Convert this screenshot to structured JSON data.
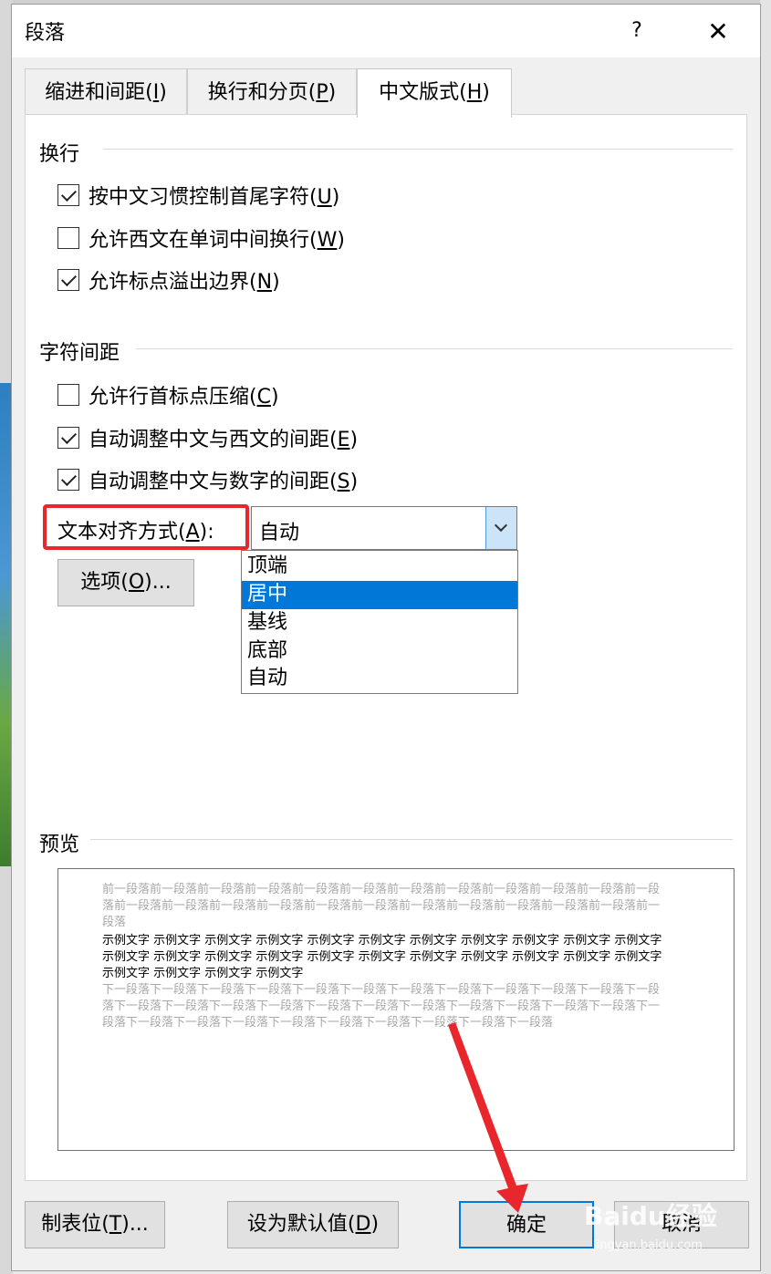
{
  "dialog": {
    "title": "段落",
    "help_label": "?",
    "close_label": "✕"
  },
  "tabs": [
    {
      "label_pre": "缩进和间距(",
      "label_key": "I",
      "label_post": ")"
    },
    {
      "label_pre": "换行和分页(",
      "label_key": "P",
      "label_post": ")"
    },
    {
      "label_pre": "中文版式(",
      "label_key": "H",
      "label_post": ")"
    }
  ],
  "line_break": {
    "title": "换行",
    "options": [
      {
        "pre": "按中文习惯控制首尾字符(",
        "key": "U",
        "post": ")",
        "checked": true
      },
      {
        "pre": "允许西文在单词中间换行(",
        "key": "W",
        "post": ")",
        "checked": false
      },
      {
        "pre": "允许标点溢出边界(",
        "key": "N",
        "post": ")",
        "checked": true
      }
    ]
  },
  "char_spacing": {
    "title": "字符间距",
    "options": [
      {
        "pre": "允许行首标点压缩(",
        "key": "C",
        "post": ")",
        "checked": false
      },
      {
        "pre": "自动调整中文与西文的间距(",
        "key": "E",
        "post": ")",
        "checked": true
      },
      {
        "pre": "自动调整中文与数字的间距(",
        "key": "S",
        "post": ")",
        "checked": true
      }
    ]
  },
  "text_alignment": {
    "label_pre": "文本对齐方式(",
    "label_key": "A",
    "label_post": "):",
    "value": "自动",
    "options": [
      "顶端",
      "居中",
      "基线",
      "底部",
      "自动"
    ],
    "highlighted_index": 1
  },
  "options_button": {
    "pre": "选项(",
    "key": "O",
    "post": ")..."
  },
  "preview": {
    "title": "预览",
    "prev_text": "前一段落前一段落前一段落前一段落前一段落前一段落前一段落前一段落前一段落前一段落前一段落前一段落前一段落前一段落前一段落前一段落前一段落前一段落前一段落前一段落前一段落前一段落前一段落前一段落",
    "sample_text": "示例文字  示例文字  示例文字  示例文字  示例文字  示例文字  示例文字  示例文字  示例文字  示例文字  示例文字  示例文字  示例文字  示例文字  示例文字  示例文字  示例文字  示例文字  示例文字  示例文字  示例文字  示例文字  示例文字  示例文字  示例文字  示例文字",
    "next_text": "下一段落下一段落下一段落下一段落下一段落下一段落下一段落下一段落下一段落下一段落下一段落下一段落下一段落下一段落下一段落下一段落下一段落下一段落下一段落下一段落下一段落下一段落下一段落下一段落下一段落下一段落下一段落下一段落下一段落下一段落下一段落下一段落下一段落"
  },
  "buttons": {
    "tabs": {
      "pre": "制表位(",
      "key": "T",
      "post": ")..."
    },
    "default": {
      "pre": "设为默认值(",
      "key": "D",
      "post": ")"
    },
    "ok": "确定",
    "cancel": "取消"
  },
  "watermark": {
    "main": "Baidu经验",
    "sub": "jingyan.baidu.com"
  },
  "colors": {
    "annotation_red": "#e8262b",
    "selection_blue": "#0078d7"
  }
}
